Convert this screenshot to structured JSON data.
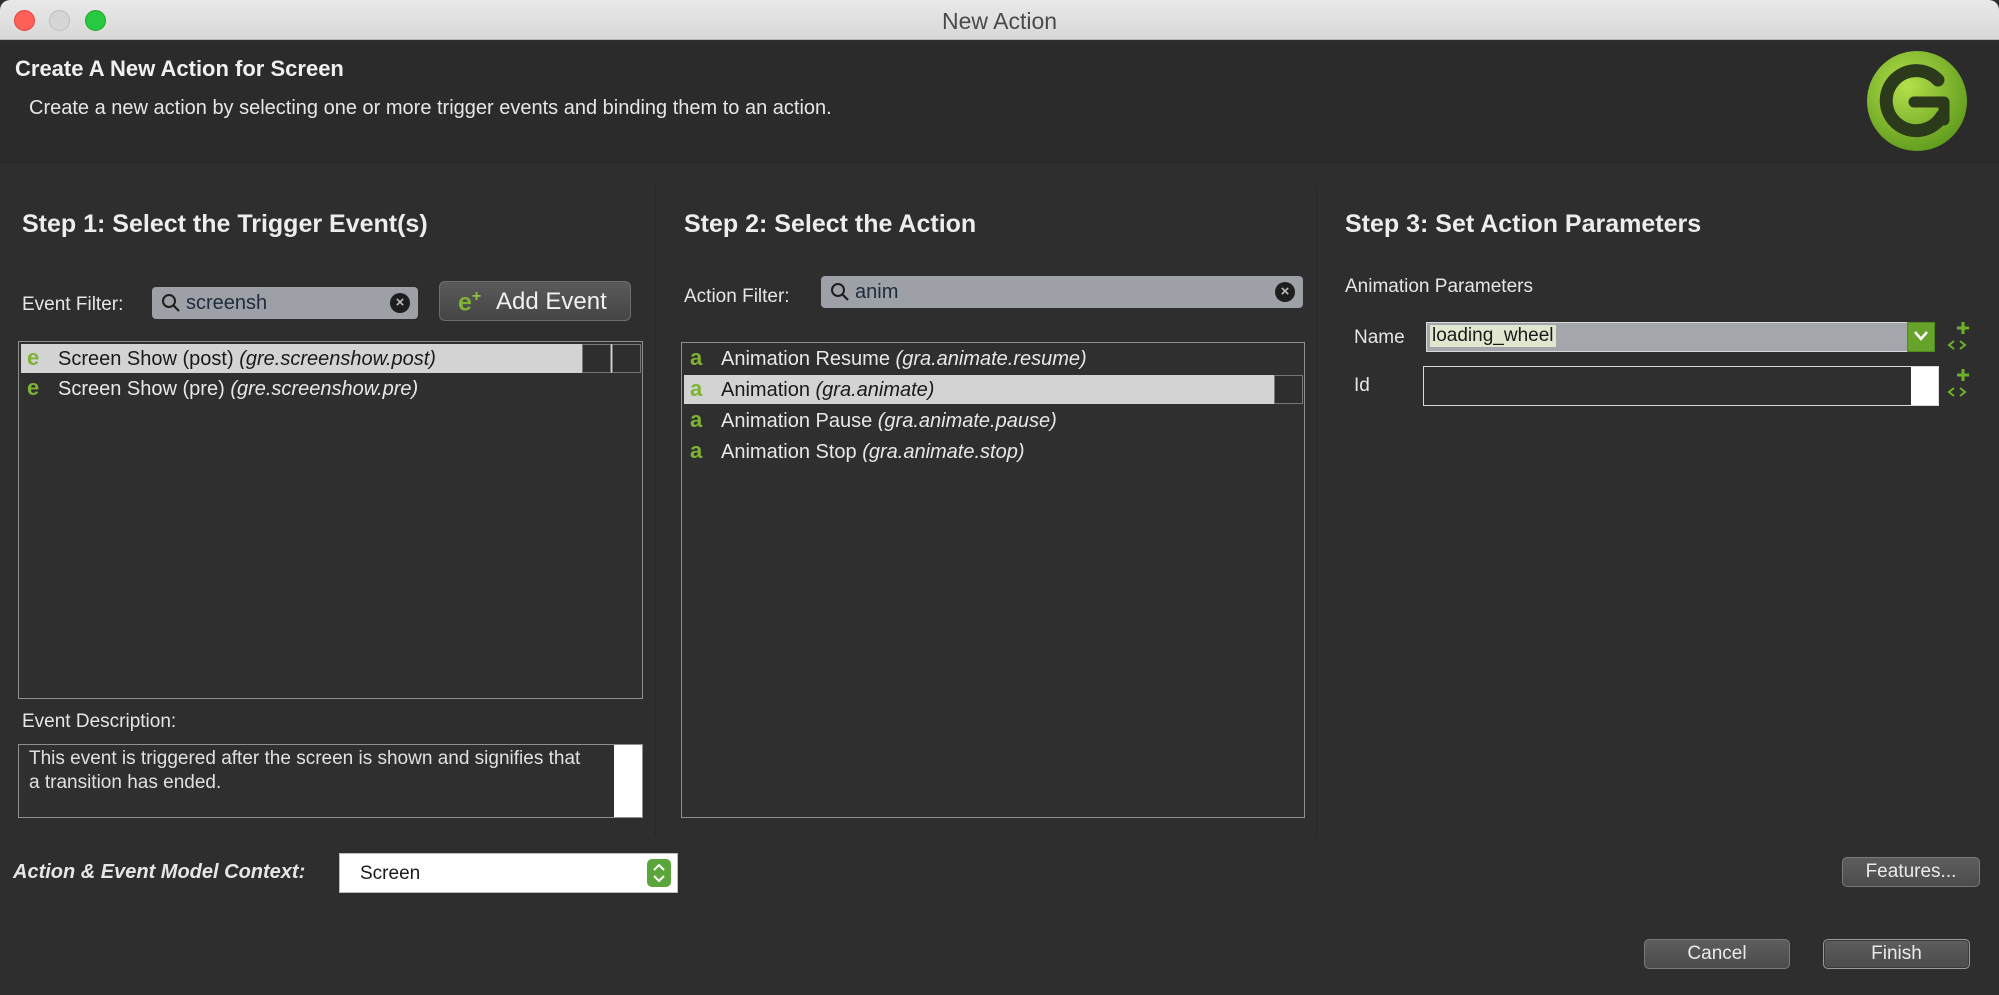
{
  "window": {
    "title": "New Action"
  },
  "header": {
    "title": "Create A New Action for Screen",
    "description": "Create a new action by selecting one or more trigger events and binding them to an action."
  },
  "step1": {
    "title": "Step 1: Select the Trigger Event(s)",
    "filter_label": "Event Filter:",
    "filter_value": "screensh",
    "add_event_label": "Add Event",
    "events": [
      {
        "name": "Screen Show (post)",
        "id": "(gre.screenshow.post)",
        "selected": true
      },
      {
        "name": "Screen Show (pre)",
        "id": "(gre.screenshow.pre)",
        "selected": false
      }
    ],
    "description_label": "Event Description:",
    "description_text": "This event is triggered after the screen is shown and signifies that a transition has ended."
  },
  "step2": {
    "title": "Step 2: Select the Action",
    "filter_label": "Action Filter:",
    "filter_value": "anim",
    "actions": [
      {
        "name": "Animation Resume",
        "id": "(gra.animate.resume)",
        "selected": false
      },
      {
        "name": "Animation",
        "id": "(gra.animate)",
        "selected": true
      },
      {
        "name": "Animation Pause",
        "id": "(gra.animate.pause)",
        "selected": false
      },
      {
        "name": "Animation Stop",
        "id": "(gra.animate.stop)",
        "selected": false
      }
    ]
  },
  "step3": {
    "title": "Step 3: Set Action Parameters",
    "section_label": "Animation Parameters",
    "name_label": "Name",
    "name_value": "loading_wheel",
    "id_label": "Id",
    "id_value": ""
  },
  "footer": {
    "context_label": "Action & Event Model Context:",
    "context_value": "Screen",
    "features_label": "Features...",
    "cancel_label": "Cancel",
    "finish_label": "Finish"
  },
  "icons": {
    "event": "event-e-icon",
    "action": "action-a-icon",
    "logo": "crank-logo-icon"
  },
  "colors": {
    "accent_green": "#7fb334",
    "background": "#2e2e2e",
    "selection": "#d3d3d3"
  }
}
